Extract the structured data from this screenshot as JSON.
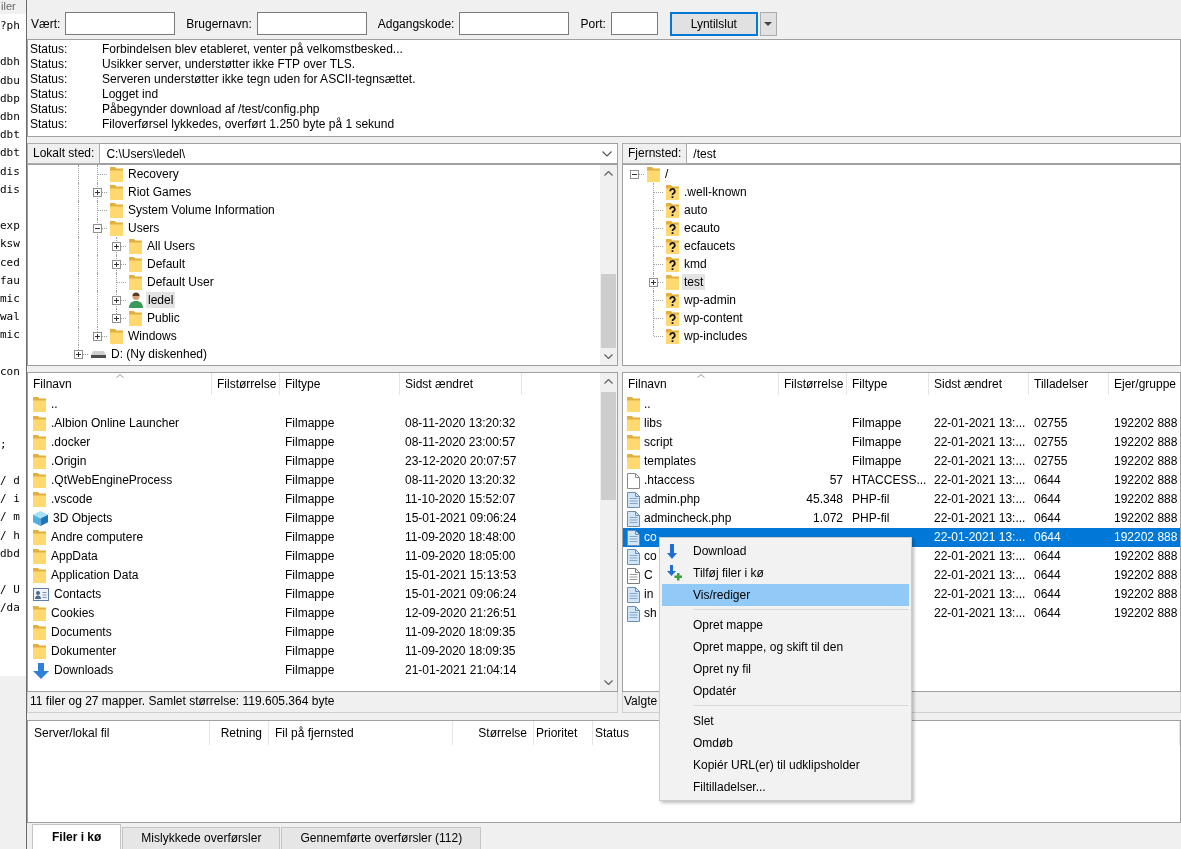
{
  "editor": {
    "title": "iler",
    "blocks": [
      [
        "?ph"
      ],
      [
        "dbh",
        "dbu",
        "dbp",
        "dbn",
        "dbt",
        "dbt",
        "dis",
        "dis"
      ],
      [
        "exp",
        "ksw",
        "ced",
        "fau",
        "mic",
        "wal",
        "mic"
      ],
      [
        "con"
      ],
      [
        ";"
      ],
      [
        "/ d",
        "/ i",
        "/ m",
        "/ h",
        "dbd"
      ],
      [
        "/ U",
        "/da"
      ]
    ]
  },
  "quickconnect": {
    "fields": [
      {
        "label": "Vært:"
      },
      {
        "label": "Brugernavn:"
      },
      {
        "label": "Adgangskode:"
      },
      {
        "label": "Port:"
      }
    ],
    "button": "Lyntilslut"
  },
  "message_log": [
    {
      "type": "Status:",
      "message": "Forbindelsen blev etableret, venter på velkomstbesked..."
    },
    {
      "type": "Status:",
      "message": "Usikker server, understøtter ikke FTP over TLS."
    },
    {
      "type": "Status:",
      "message": "Serveren understøtter ikke tegn uden for ASCII-tegnsættet."
    },
    {
      "type": "Status:",
      "message": "Logget ind"
    },
    {
      "type": "Status:",
      "message": "Påbegynder download af /test/config.php"
    },
    {
      "type": "Status:",
      "message": "Filoverførsel lykkedes, overført 1.250 byte på 1 sekund"
    }
  ],
  "local": {
    "site_label": "Lokalt sted:",
    "path": "C:\\Users\\ledel\\",
    "tree": [
      {
        "children": [
          {
            "label": "Recovery",
            "kind": "folder",
            "selected": false
          },
          {
            "label": "Riot Games",
            "kind": "folder",
            "expanded": false,
            "selected": false
          },
          {
            "label": "System Volume Information",
            "kind": "folder",
            "selected": false
          },
          {
            "label": "Users",
            "kind": "folder",
            "expanded": true,
            "selected": false,
            "children": [
              {
                "label": "All Users",
                "kind": "folder",
                "expanded": false,
                "selected": false
              },
              {
                "label": "Default",
                "kind": "folder",
                "expanded": false,
                "selected": false
              },
              {
                "label": "Default User",
                "kind": "folder",
                "selected": false
              },
              {
                "label": "ledel",
                "kind": "user",
                "expanded": false,
                "selected": true
              },
              {
                "label": "Public",
                "kind": "folder",
                "expanded": false,
                "selected": false
              }
            ]
          },
          {
            "label": "Windows",
            "kind": "folder",
            "expanded": false,
            "selected": false
          }
        ]
      },
      {
        "label": "D: (Ny diskenhed)",
        "kind": "drive",
        "expanded": false,
        "selected": false
      }
    ],
    "columns": [
      {
        "label": "Filnavn",
        "sorted": true
      },
      {
        "label": "Filstørrelse",
        "sorted": false
      },
      {
        "label": "Filtype",
        "sorted": false
      },
      {
        "label": "Sidst ændret",
        "sorted": false
      }
    ],
    "rows": [
      {
        "name": "..",
        "kind": "folder",
        "selected": false
      },
      {
        "name": ".Albion Online Launcher",
        "type": "Filmappe",
        "modified": "08-11-2020 13:20:32",
        "kind": "folder",
        "selected": false
      },
      {
        "name": ".docker",
        "type": "Filmappe",
        "modified": "08-11-2020 23:00:57",
        "kind": "folder",
        "selected": false
      },
      {
        "name": ".Origin",
        "type": "Filmappe",
        "modified": "23-12-2020 20:07:57",
        "kind": "folder",
        "selected": false
      },
      {
        "name": ".QtWebEngineProcess",
        "type": "Filmappe",
        "modified": "08-11-2020 13:20:32",
        "kind": "folder",
        "selected": false
      },
      {
        "name": ".vscode",
        "type": "Filmappe",
        "modified": "11-10-2020 15:52:07",
        "kind": "folder",
        "selected": false
      },
      {
        "name": "3D Objects",
        "type": "Filmappe",
        "modified": "15-01-2021 09:06:24",
        "kind": "objects3d",
        "selected": false
      },
      {
        "name": "Andre computere",
        "type": "Filmappe",
        "modified": "11-09-2020 18:48:00",
        "kind": "folder",
        "selected": false
      },
      {
        "name": "AppData",
        "type": "Filmappe",
        "modified": "11-09-2020 18:05:00",
        "kind": "folder",
        "selected": false
      },
      {
        "name": "Application Data",
        "type": "Filmappe",
        "modified": "15-01-2021 15:13:53",
        "kind": "folder",
        "selected": false
      },
      {
        "name": "Contacts",
        "type": "Filmappe",
        "modified": "15-01-2021 09:06:24",
        "kind": "contacts",
        "selected": false
      },
      {
        "name": "Cookies",
        "type": "Filmappe",
        "modified": "12-09-2020 21:26:51",
        "kind": "folder",
        "selected": false
      },
      {
        "name": "Documents",
        "type": "Filmappe",
        "modified": "11-09-2020 18:09:35",
        "kind": "folder",
        "selected": false
      },
      {
        "name": "Dokumenter",
        "type": "Filmappe",
        "modified": "11-09-2020 18:09:35",
        "kind": "folder",
        "selected": false
      },
      {
        "name": "Downloads",
        "type": "Filmappe",
        "modified": "21-01-2021 21:04:14",
        "kind": "download",
        "selected": false
      }
    ],
    "status": "11 filer og 27 mapper. Samlet størrelse: 119.605.364 byte"
  },
  "remote": {
    "site_label": "Fjernsted:",
    "path": "/test",
    "tree": [
      {
        "label": "/",
        "kind": "folder",
        "expanded": true,
        "selected": false,
        "children": [
          {
            "label": ".well-known",
            "kind": "unknown",
            "selected": false
          },
          {
            "label": "auto",
            "kind": "unknown",
            "selected": false
          },
          {
            "label": "ecauto",
            "kind": "unknown",
            "selected": false
          },
          {
            "label": "ecfaucets",
            "kind": "unknown",
            "selected": false
          },
          {
            "label": "kmd",
            "kind": "unknown",
            "selected": false
          },
          {
            "label": "test",
            "kind": "folder",
            "expanded": false,
            "selected": true
          },
          {
            "label": "wp-admin",
            "kind": "unknown",
            "selected": false
          },
          {
            "label": "wp-content",
            "kind": "unknown",
            "selected": false
          },
          {
            "label": "wp-includes",
            "kind": "unknown",
            "selected": false
          }
        ]
      }
    ],
    "columns": [
      {
        "label": "Filnavn",
        "sorted": true
      },
      {
        "label": "Filstørrelse",
        "sorted": false
      },
      {
        "label": "Filtype",
        "sorted": false
      },
      {
        "label": "Sidst ændret",
        "sorted": false
      },
      {
        "label": "Tilladelser",
        "sorted": false
      },
      {
        "label": "Ejer/gruppe",
        "sorted": false
      }
    ],
    "rows": [
      {
        "name": "..",
        "kind": "folder",
        "selected": false
      },
      {
        "name": "libs",
        "type": "Filmappe",
        "modified": "22-01-2021 13:...",
        "permissions": "02755",
        "owner": "192202 888",
        "kind": "folder",
        "selected": false
      },
      {
        "name": "script",
        "type": "Filmappe",
        "modified": "22-01-2021 13:...",
        "permissions": "02755",
        "owner": "192202 888",
        "kind": "folder",
        "selected": false
      },
      {
        "name": "templates",
        "type": "Filmappe",
        "modified": "22-01-2021 13:...",
        "permissions": "02755",
        "owner": "192202 888",
        "kind": "folder",
        "selected": false
      },
      {
        "name": ".htaccess",
        "size": "57",
        "type": "HTACCESS...",
        "modified": "22-01-2021 13:...",
        "permissions": "0644",
        "owner": "192202 888",
        "kind": "file",
        "selected": false
      },
      {
        "name": "admin.php",
        "size": "45.348",
        "type": "PHP-fil",
        "modified": "22-01-2021 13:...",
        "permissions": "0644",
        "owner": "192202 888",
        "kind": "php",
        "selected": false
      },
      {
        "name": "admincheck.php",
        "size": "1.072",
        "type": "PHP-fil",
        "modified": "22-01-2021 13:...",
        "permissions": "0644",
        "owner": "192202 888",
        "kind": "php",
        "selected": false
      },
      {
        "name": "co",
        "modified": "22-01-2021 13:...",
        "permissions": "0644",
        "owner": "192202 888",
        "kind": "php",
        "selected": true
      },
      {
        "name": "co",
        "modified": "22-01-2021 13:...",
        "permissions": "0644",
        "owner": "192202 888",
        "kind": "php",
        "selected": false
      },
      {
        "name": "C",
        "modified": "22-01-2021 13:...",
        "permissions": "0644",
        "owner": "192202 888",
        "kind": "text",
        "selected": false
      },
      {
        "name": "in",
        "modified": "22-01-2021 13:...",
        "permissions": "0644",
        "owner": "192202 888",
        "kind": "php",
        "selected": false
      },
      {
        "name": "sh",
        "modified": "22-01-2021 13:...",
        "permissions": "0644",
        "owner": "192202 888",
        "kind": "php",
        "selected": false
      }
    ],
    "status": "Valgte"
  },
  "queue": {
    "columns": [
      "Server/lokal fil",
      "Retning",
      "Fil på fjernsted",
      "Størrelse",
      "Prioritet",
      "Status"
    ],
    "tabs": [
      {
        "label": "Filer i kø",
        "selected": true
      },
      {
        "label": "Mislykkede overførsler",
        "selected": false
      },
      {
        "label": "Gennemførte overførsler (112)",
        "selected": false
      }
    ]
  },
  "context_menu": {
    "items": [
      {
        "kind": "download",
        "label": "Download",
        "selected": false
      },
      {
        "kind": "enqueue",
        "label": "Tilføj filer i kø",
        "selected": false
      },
      {
        "kind": "plain",
        "label": "Vis/rediger",
        "selected": true
      },
      {
        "kind": "separator"
      },
      {
        "kind": "plain",
        "label": "Opret mappe",
        "selected": false
      },
      {
        "kind": "plain",
        "label": "Opret mappe, og skift til den",
        "selected": false
      },
      {
        "kind": "plain",
        "label": "Opret ny fil",
        "selected": false
      },
      {
        "kind": "plain",
        "label": "Opdatér",
        "selected": false
      },
      {
        "kind": "separator"
      },
      {
        "kind": "plain",
        "label": "Slet",
        "selected": false
      },
      {
        "kind": "plain",
        "label": "Omdøb",
        "selected": false
      },
      {
        "kind": "plain",
        "label": "Kopiér URL(er) til udklipsholder",
        "selected": false
      },
      {
        "kind": "plain",
        "label": "Filtilladelser...",
        "selected": false
      }
    ]
  }
}
